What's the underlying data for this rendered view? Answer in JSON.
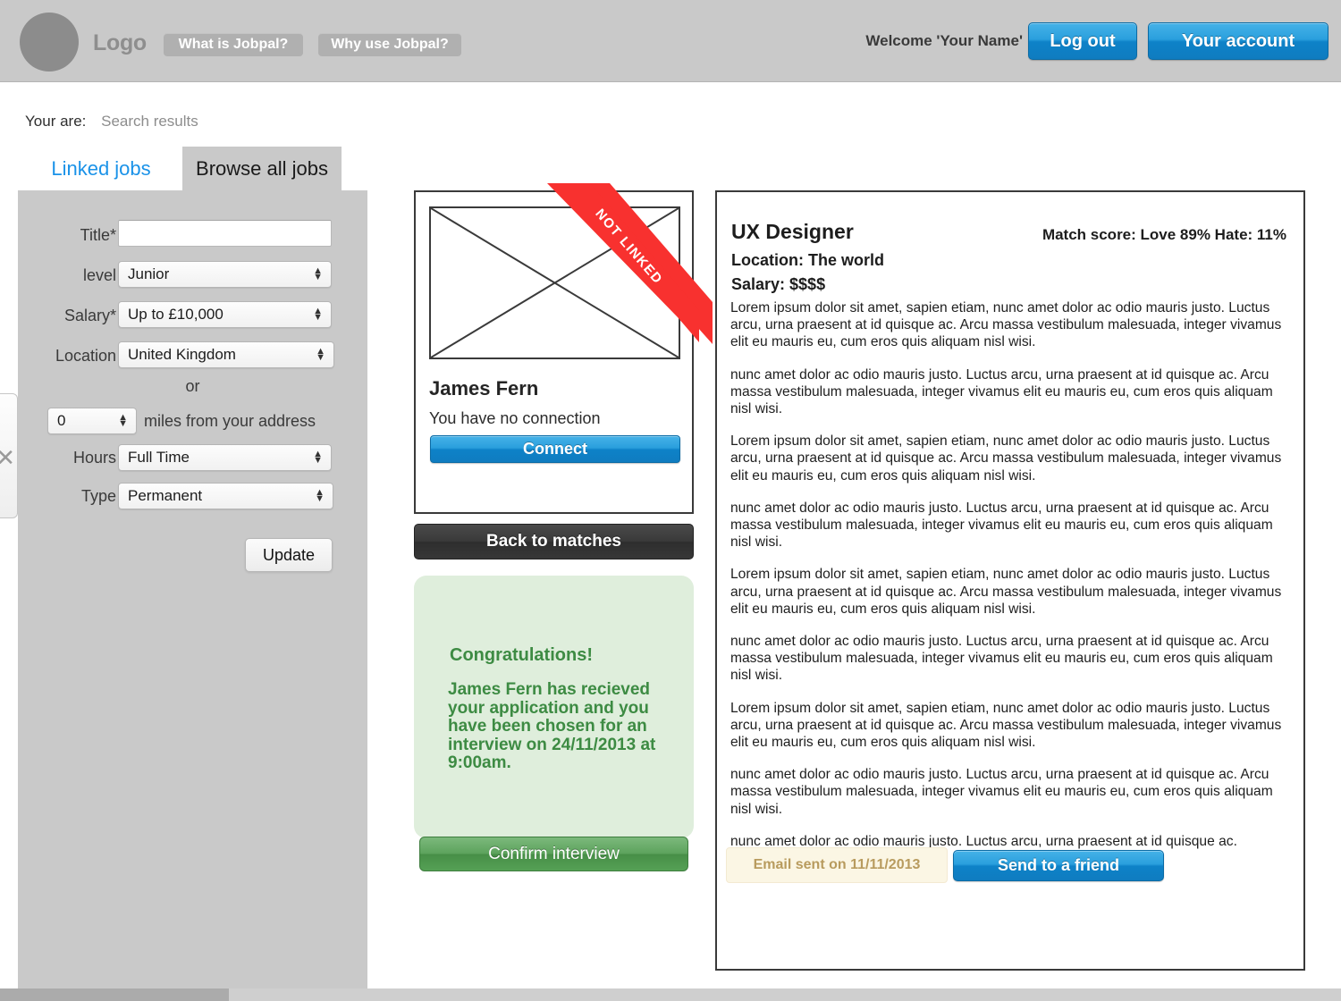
{
  "header": {
    "logo_text": "Logo",
    "nav": [
      {
        "label": "What is Jobpal?"
      },
      {
        "label": "Why use Jobpal?"
      }
    ],
    "welcome": "Welcome 'Your Name'",
    "logout_label": "Log out",
    "account_label": "Your account",
    "background_color": "#c9c9c9",
    "accent_color": "#0e82c8"
  },
  "breadcrumb": {
    "label": "Your are:",
    "value": "Search results"
  },
  "tabs": [
    {
      "label": "Linked jobs",
      "active": false
    },
    {
      "label": "Browse all jobs",
      "active": true
    }
  ],
  "search_form": {
    "title": {
      "label": "Title*",
      "value": "",
      "placeholder": ""
    },
    "level": {
      "label": "level",
      "value": "Junior"
    },
    "salary": {
      "label": "Salary*",
      "value": "Up to £10,000"
    },
    "location": {
      "label": "Location",
      "value": "United Kingdom"
    },
    "or_label": "or",
    "miles": {
      "value": "0",
      "suffix": "miles from your address"
    },
    "hours": {
      "label": "Hours",
      "value": "Full Time"
    },
    "type": {
      "label": "Type",
      "value": "Permanent"
    },
    "update_label": "Update"
  },
  "edge_widget": {
    "glyph": "✕"
  },
  "person_card": {
    "ribbon_label": "NOT LINKED",
    "ribbon_color": "#f8312f",
    "name": "James Fern",
    "connection_status": "You have no connection",
    "connect_label": "Connect"
  },
  "back_button": {
    "label": "Back to matches"
  },
  "congratulations": {
    "title": "Congratulations!",
    "body": "James Fern has recieved your application and you have been chosen for an interview on 24/11/2013 at 9:00am.",
    "interview_date": "24/11/2013",
    "interview_time": "9:00am",
    "confirm_label": "Confirm interview",
    "background_color": "#dfeedc",
    "text_color": "#3d8b43"
  },
  "job": {
    "title": "UX Designer",
    "match_score": "Match score: Love 89% Hate: 11%",
    "love_percent": 89,
    "hate_percent": 11,
    "location": "Location: The world",
    "salary": "Salary: $$$$",
    "paragraphs": [
      "Lorem ipsum dolor sit amet, sapien etiam, nunc amet dolor ac odio mauris justo. Luctus arcu, urna praesent at id quisque ac. Arcu massa vestibulum malesuada, integer vivamus elit eu mauris eu, cum eros quis aliquam nisl wisi.",
      "nunc amet dolor ac odio mauris justo. Luctus arcu, urna praesent at id quisque ac. Arcu massa vestibulum malesuada, integer vivamus elit eu mauris eu, cum eros quis aliquam nisl wisi.",
      "Lorem ipsum dolor sit amet, sapien etiam, nunc amet dolor ac odio mauris justo. Luctus arcu, urna praesent at id quisque ac. Arcu massa vestibulum malesuada, integer vivamus elit eu mauris eu, cum eros quis aliquam nisl wisi.",
      "nunc amet dolor ac odio mauris justo. Luctus arcu, urna praesent at id quisque ac. Arcu massa vestibulum malesuada, integer vivamus elit eu mauris eu, cum eros quis aliquam nisl wisi.",
      "Lorem ipsum dolor sit amet, sapien etiam, nunc amet dolor ac odio mauris justo. Luctus arcu, urna praesent at id quisque ac. Arcu massa vestibulum malesuada, integer vivamus elit eu mauris eu, cum eros quis aliquam nisl wisi.",
      "nunc amet dolor ac odio mauris justo. Luctus arcu, urna praesent at id quisque ac. Arcu massa vestibulum malesuada, integer vivamus elit eu mauris eu, cum eros quis aliquam nisl wisi.",
      "Lorem ipsum dolor sit amet, sapien etiam, nunc amet dolor ac odio mauris justo. Luctus arcu, urna praesent at id quisque ac. Arcu massa vestibulum malesuada, integer vivamus elit eu mauris eu, cum eros quis aliquam nisl wisi.",
      "nunc amet dolor ac odio mauris justo. Luctus arcu, urna praesent at id quisque ac. Arcu massa vestibulum malesuada, integer vivamus elit eu mauris eu, cum eros quis aliquam nisl wisi.",
      "nunc amet dolor ac odio mauris justo. Luctus arcu, urna praesent at id quisque ac."
    ],
    "email_sent_note": "Email sent on 11/11/2013",
    "send_friend_label": "Send to a friend"
  }
}
